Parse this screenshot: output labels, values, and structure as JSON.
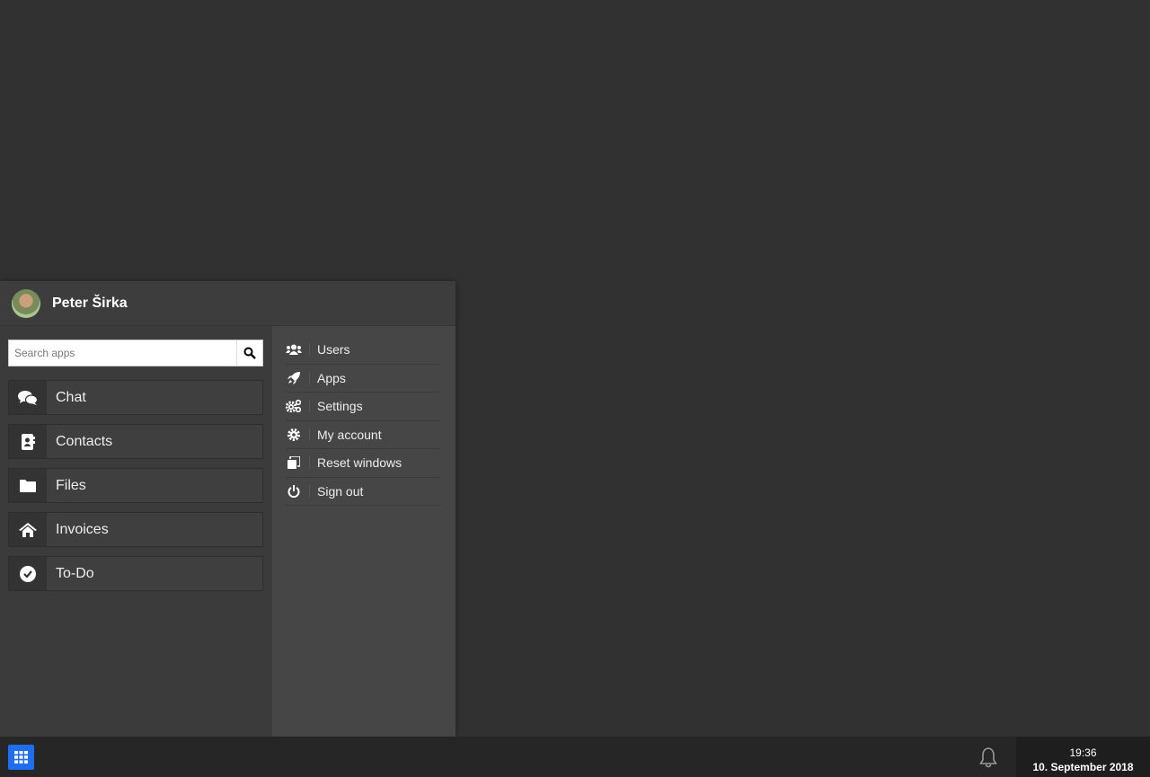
{
  "user": {
    "name": "Peter Širka"
  },
  "search": {
    "placeholder": "Search apps"
  },
  "apps": [
    {
      "label": "Chat",
      "icon": "comments-icon"
    },
    {
      "label": "Contacts",
      "icon": "address-book-icon"
    },
    {
      "label": "Files",
      "icon": "folder-icon"
    },
    {
      "label": "Invoices",
      "icon": "home-icon"
    },
    {
      "label": "To-Do",
      "icon": "check-circle-icon"
    }
  ],
  "menu": [
    {
      "label": "Users",
      "icon": "users-icon"
    },
    {
      "label": "Apps",
      "icon": "rocket-icon"
    },
    {
      "label": "Settings",
      "icon": "cogs-icon"
    },
    {
      "label": "My account",
      "icon": "cog-icon"
    },
    {
      "label": "Reset windows",
      "icon": "windows-icon"
    },
    {
      "label": "Sign out",
      "icon": "power-icon"
    }
  ],
  "taskbar": {
    "time": "19:36",
    "date": "10. September 2018"
  },
  "colors": {
    "accent": "#1f6ef0"
  }
}
